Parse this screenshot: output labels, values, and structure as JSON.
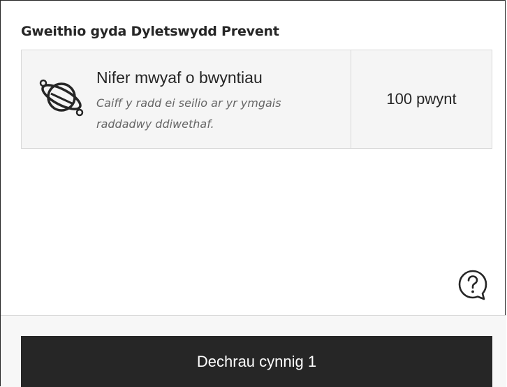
{
  "title": "Gweithio gyda Dyletswydd Prevent",
  "grading": {
    "icon": "planet-icon",
    "heading": "Nifer mwyaf o bwyntiau",
    "description": "Caiff y radd ei seilio ar yr ymgais raddadwy ddiwethaf.",
    "points": "100 pwynt"
  },
  "help_icon": "help-bubble-icon",
  "start_button": {
    "label": "Dechrau cynnig 1"
  },
  "colors": {
    "text": "#262626",
    "muted_text": "#666666",
    "card_background": "#f5f5f5",
    "card_border": "#d9d9d9",
    "button_background": "#262626",
    "button_text": "#ffffff",
    "footer_background": "#f7f7f7"
  }
}
